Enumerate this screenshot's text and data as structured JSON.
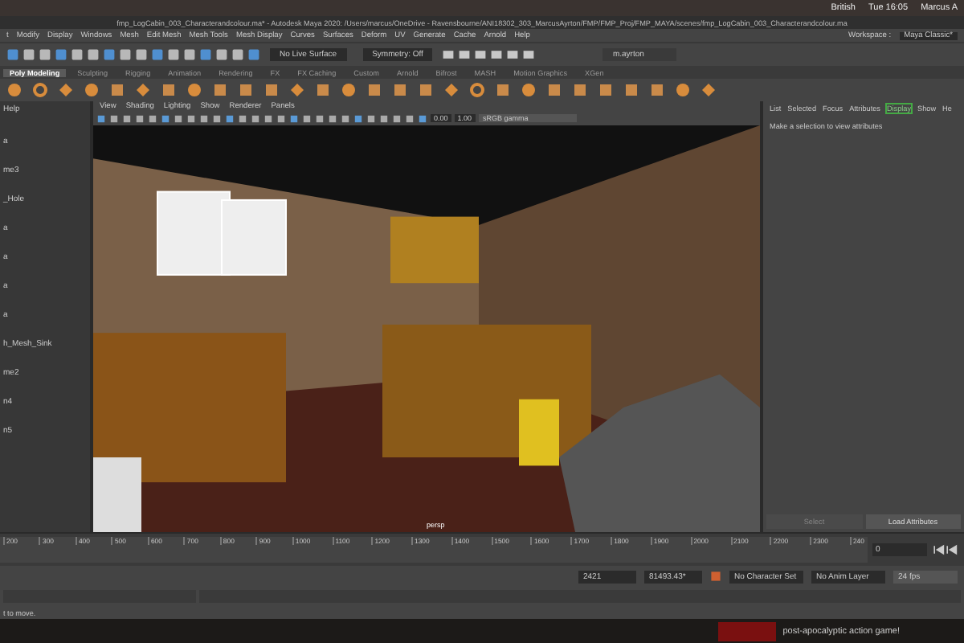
{
  "menubar": {
    "status_items": [
      "British",
      "Tue 16:05",
      "Marcus A"
    ]
  },
  "window": {
    "title": "fmp_LogCabin_003_Characterandcolour.ma* - Autodesk Maya 2020: /Users/marcus/OneDrive - Ravensbourne/ANI18302_303_MarcusAyrton/FMP/FMP_Proj/FMP_MAYA/scenes/fmp_LogCabin_003_Characterandcolour.ma"
  },
  "menu": [
    "t",
    "Modify",
    "Display",
    "Windows",
    "Mesh",
    "Edit Mesh",
    "Mesh Tools",
    "Mesh Display",
    "Curves",
    "Surfaces",
    "Deform",
    "UV",
    "Generate",
    "Cache",
    "Arnold",
    "Help"
  ],
  "workspace": {
    "label": "Workspace :",
    "value": "Maya Classic*"
  },
  "status_line": {
    "live_surface": "No Live Surface",
    "symmetry": "Symmetry: Off",
    "user": "m.ayrton"
  },
  "shelf_tabs": [
    {
      "label": "Poly Modeling",
      "selected": true
    },
    {
      "label": "Sculpting",
      "selected": false
    },
    {
      "label": "Rigging",
      "selected": false
    },
    {
      "label": "Animation",
      "selected": false
    },
    {
      "label": "Rendering",
      "selected": false
    },
    {
      "label": "FX",
      "selected": false
    },
    {
      "label": "FX Caching",
      "selected": false
    },
    {
      "label": "Custom",
      "selected": false
    },
    {
      "label": "Arnold",
      "selected": false
    },
    {
      "label": "Bifrost",
      "selected": false
    },
    {
      "label": "MASH",
      "selected": false
    },
    {
      "label": "Motion Graphics",
      "selected": false
    },
    {
      "label": "XGen",
      "selected": false
    }
  ],
  "outliner": {
    "menu": "Help",
    "items": [
      "a",
      "me3",
      "_Hole",
      "a",
      "a",
      "a",
      "a",
      "h_Mesh_Sink",
      "me2",
      "n4",
      "n5"
    ]
  },
  "viewport": {
    "menu": [
      "View",
      "Shading",
      "Lighting",
      "Show",
      "Renderer",
      "Panels"
    ],
    "exposure": "0.00",
    "gamma": "1.00",
    "color_space": "sRGB gamma",
    "camera": "persp"
  },
  "attribute_editor": {
    "tabs": [
      {
        "label": "List",
        "selected": false
      },
      {
        "label": "Selected",
        "selected": false
      },
      {
        "label": "Focus",
        "selected": false
      },
      {
        "label": "Attributes",
        "selected": false
      },
      {
        "label": "Display",
        "selected": true
      },
      {
        "label": "Show",
        "selected": false
      },
      {
        "label": "He",
        "selected": false
      }
    ],
    "message": "Make a selection to view attributes",
    "buttons": [
      "Select",
      "Load Attributes"
    ]
  },
  "timeline": {
    "ticks": [
      "200",
      "300",
      "400",
      "500",
      "600",
      "700",
      "800",
      "900",
      "1000",
      "1100",
      "1200",
      "1300",
      "1400",
      "1500",
      "1600",
      "1700",
      "1800",
      "1900",
      "2000",
      "2100",
      "2200",
      "2300",
      "240"
    ],
    "current_frame": "0"
  },
  "range": {
    "end_time": "2421",
    "max_time": "81493.43*",
    "character_set": "No Character Set",
    "anim_layer": "No Anim Layer",
    "fps": "24 fps"
  },
  "help_line": "t to move.",
  "ad": {
    "text": "post-apocalyptic action game!"
  }
}
